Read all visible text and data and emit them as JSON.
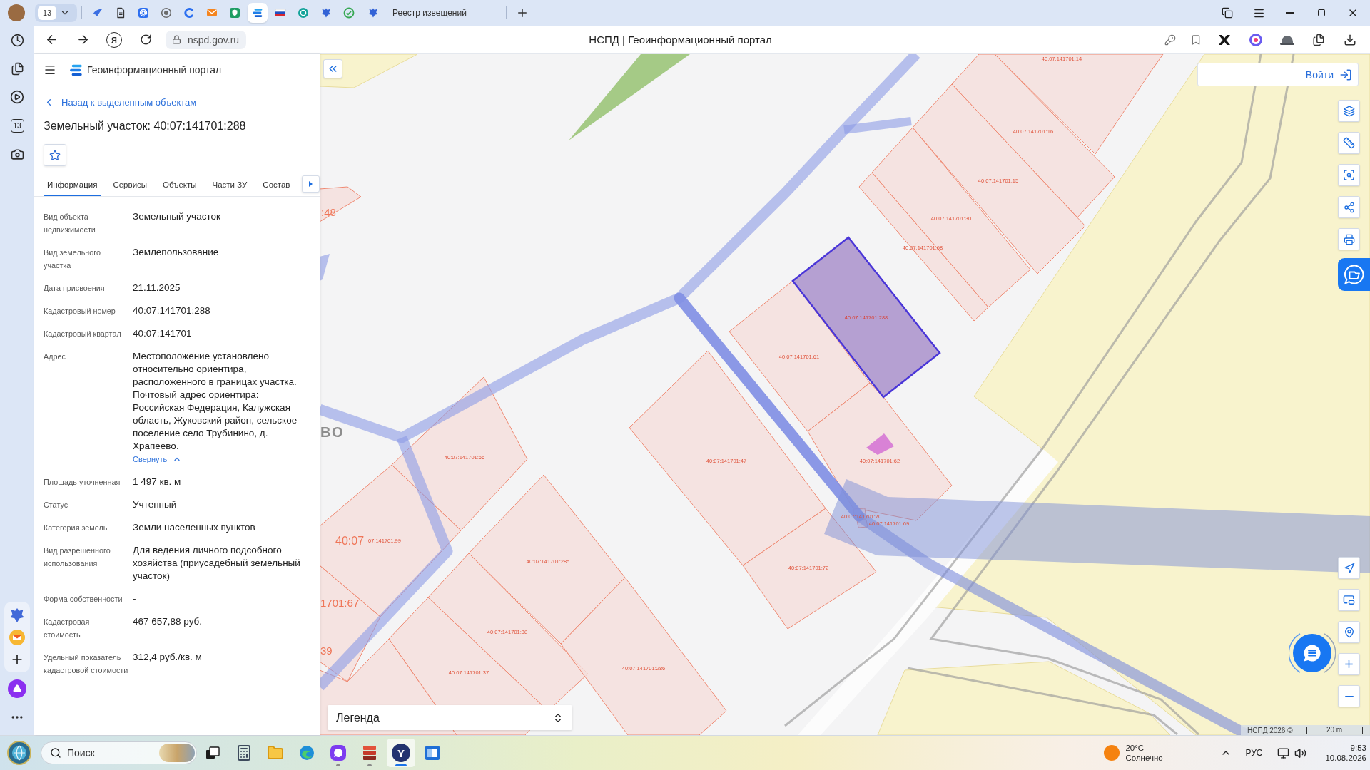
{
  "browser": {
    "tab_count": "13",
    "tabs": [
      {
        "selected": false
      },
      {
        "selected": false
      },
      {
        "selected": false
      },
      {
        "selected": false
      },
      {
        "selected": false
      },
      {
        "selected": false
      },
      {
        "selected": false
      },
      {
        "selected": true
      },
      {
        "selected": false
      },
      {
        "selected": false
      },
      {
        "selected": false
      },
      {
        "selected": false
      },
      {
        "title": "Реестр извещений",
        "selected": false
      }
    ],
    "home_button": "Я",
    "address": "nspd.gov.ru",
    "page_title": "НСПД | Геоинформационный портал",
    "sidebar": {
      "calendar_day": "13"
    }
  },
  "portal": {
    "app_title": "Геоинформационный портал",
    "back_link": "Назад к выделенным объектам",
    "heading": "Земельный участок: 40:07:141701:288",
    "favorite": false,
    "tabs": [
      {
        "label": "Информация",
        "selected": true
      },
      {
        "label": "Сервисы",
        "selected": false
      },
      {
        "label": "Объекты",
        "selected": false
      },
      {
        "label": "Части ЗУ",
        "selected": false
      },
      {
        "label": "Состав",
        "selected": false
      }
    ],
    "fields": [
      {
        "label": "Вид объекта недвижимости",
        "value": "Земельный участок"
      },
      {
        "label": "Вид земельного участка",
        "value": "Землепользование"
      },
      {
        "label": "Дата присвоения",
        "value": "21.11.2025"
      },
      {
        "label": "Кадастровый номер",
        "value": "40:07:141701:288"
      },
      {
        "label": "Кадастровый квартал",
        "value": "40:07:141701"
      },
      {
        "label": "Адрес",
        "value": "Местоположение установлено относительно ориентира, расположенного в границах участка. Почтовый адрес ориентира: Российская Федерация, Калужская область, Жуковский район, сельское поселение село Трубинино, д. Храпеево.",
        "toggle": "Свернуть",
        "expanded": true
      },
      {
        "label": "Площадь уточненная",
        "value": "1 497 кв. м"
      },
      {
        "label": "Статус",
        "value": "Учтенный"
      },
      {
        "label": "Категория земель",
        "value": "Земли населенных пунктов"
      },
      {
        "label": "Вид разрешенного использования",
        "value": "Для ведения личного подсобного хозяйства (приусадебный земельный участок)"
      },
      {
        "label": "Форма собственности",
        "value": "-"
      },
      {
        "label": "Кадастровая стоимость",
        "value": "467 657,88 руб."
      },
      {
        "label": "Удельный показатель кадастровой стоимости",
        "value": "312,4 руб./кв. м"
      }
    ]
  },
  "map": {
    "login_button": "Войти",
    "cut_labels": [
      {
        "text": ":48",
        "kind": "quarter"
      },
      {
        "text": "ВО",
        "kind": "place"
      },
      {
        "text": "40:07",
        "kind": "quarter"
      },
      {
        "text": "1701:67",
        "kind": "quarter"
      },
      {
        "text": "39",
        "kind": "quarter"
      }
    ],
    "parcels": [
      {
        "label": "40:07:141701:14",
        "selected": false
      },
      {
        "label": "40:07:141701:16",
        "selected": false
      },
      {
        "label": "40:07:141701:15",
        "selected": false
      },
      {
        "label": "40:07:141701:30",
        "selected": false
      },
      {
        "label": "40:07:141701:68",
        "selected": false
      },
      {
        "label": "40:07:141701:288",
        "selected": true
      },
      {
        "label": "40:07:141701:61",
        "selected": false
      },
      {
        "label": "40:07:141701:62",
        "selected": false
      },
      {
        "label": "40:07:141701:70",
        "selected": false
      },
      {
        "label": "40:07:141701:69",
        "selected": false
      },
      {
        "label": "40:07:141701:72",
        "selected": false
      },
      {
        "label": "40:07:141701:47",
        "selected": false
      },
      {
        "label": "40:07:141701:66",
        "selected": false
      },
      {
        "label": "07:141701:99",
        "selected": false
      },
      {
        "label": "40:07:141701:285",
        "selected": false
      },
      {
        "label": "40:07:141701:38",
        "selected": false
      },
      {
        "label": "40:07:141701:37",
        "selected": false
      },
      {
        "label": "40:07:141701:286",
        "selected": false
      }
    ],
    "legend": "Легенда",
    "copyright": "НСПД 2026 ©",
    "scale": "20 m"
  },
  "taskbar": {
    "search_placeholder": "Поиск",
    "apps": [
      {
        "running": false,
        "selected": false
      },
      {
        "running": false,
        "selected": false
      },
      {
        "running": false,
        "selected": false
      },
      {
        "running": false,
        "selected": false
      },
      {
        "running": true,
        "selected": false
      },
      {
        "running": true,
        "selected": false
      },
      {
        "label": "Y",
        "running": true,
        "selected": true
      },
      {
        "running": false,
        "selected": false
      }
    ],
    "weather": {
      "temperature": "20°C",
      "condition": "Солнечно"
    },
    "language": "РУС",
    "time": "9:53",
    "date": "10.08.2026"
  }
}
